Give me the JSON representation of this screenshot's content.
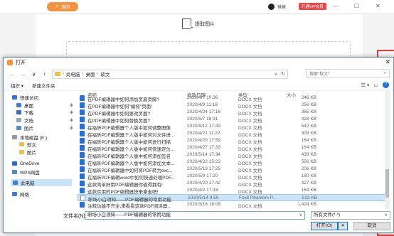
{
  "background_app": {
    "back_label": "返回",
    "user_name": "爸爸",
    "vip_label": "开通VIP会员",
    "window_controls": [
      "—",
      "☐",
      "✕"
    ],
    "extract_label": "提取图片"
  },
  "dialog": {
    "title": "打开",
    "nav": {
      "back": "←",
      "forward": "→",
      "dropdown": "∨",
      "up": "↑",
      "breadcrumb": [
        "此电脑",
        "桌面",
        "软文"
      ],
      "search_placeholder": "搜索\"软文\""
    },
    "toolbar": {
      "organize": "组织 ▾",
      "new_folder": "新建文件夹",
      "view_icon": "☰ ▾",
      "pane_icon": "▭"
    },
    "sidebar": [
      {
        "label": "快速访问",
        "icon": "star-icon",
        "color": "#2b78d4"
      },
      {
        "label": "桌面",
        "icon": "desktop-icon",
        "color": "#3a7fd9",
        "pinned": true
      },
      {
        "label": "下载",
        "icon": "download-icon",
        "color": "#2b6fd6",
        "pinned": true
      },
      {
        "label": "文档",
        "icon": "document-icon",
        "color": "#9aa5b4",
        "pinned": true
      },
      {
        "label": "图片",
        "icon": "picture-icon",
        "color": "#4e8fd6",
        "pinned": true
      },
      {
        "label": "本地磁盘 (E:)",
        "icon": "drive-icon",
        "color": "#8f98a4"
      },
      {
        "label": "软文",
        "icon": "folder-icon",
        "color": "#f1c04d"
      },
      {
        "label": "图片",
        "icon": "folder-icon",
        "color": "#f1c04d"
      },
      {
        "label": "OneDrive",
        "icon": "cloud-icon",
        "color": "#1f72c8"
      },
      {
        "label": "WPS网盘",
        "icon": "cloud-icon",
        "color": "#4a8bd4"
      },
      {
        "label": "此电脑",
        "icon": "computer-icon",
        "color": "#3a7fd9",
        "selected": true
      },
      {
        "label": "网络",
        "icon": "network-icon",
        "color": "#3a7fd9"
      }
    ],
    "columns": {
      "name": "名称",
      "date": "修改日期",
      "type": "类型",
      "size": "大小"
    },
    "files": [
      {
        "name": "在PDF编辑器中如何添加页眉页脚?",
        "date": "2020/4/7 10:36",
        "type": "DOCX 文档",
        "size": "246 KB",
        "icon": "word"
      },
      {
        "name": "在PDF编辑器中如何\"编排\"页面!",
        "date": "2020/4/9 11:18",
        "type": "DOCX 文档",
        "size": "256 KB",
        "icon": "word"
      },
      {
        "name": "在PDF编辑器中如何更改页面?",
        "date": "2020/4/24 17:16",
        "type": "DOCX 文档",
        "size": "385 KB",
        "icon": "word"
      },
      {
        "name": "在PDF编辑器中如何替换页面?",
        "date": "2020/5/7 18:31",
        "type": "DOCX 文档",
        "size": "428 KB",
        "icon": "word"
      },
      {
        "name": "在福昕PDF编辑器个人版中如何调整图像",
        "date": "2020/5/12 17:49",
        "type": "DOCX 文档",
        "size": "542 KB",
        "icon": "word"
      },
      {
        "name": "在福昕PDF编辑器个人版中如何对文件进...",
        "date": "2020/4/21 11:22",
        "type": "DOCX 文档",
        "size": "309 KB",
        "icon": "word"
      },
      {
        "name": "在福昕PDF编辑器个人版中如何进行扫描",
        "date": "2020/4/29 17:59",
        "type": "DOCX 文档",
        "size": "164 KB",
        "icon": "word"
      },
      {
        "name": "在福昕PDF编辑器个人版中如何快速定位...",
        "date": "2020/4/27 17:33",
        "type": "DOCX 文档",
        "size": "164 KB",
        "icon": "word"
      },
      {
        "name": "在福昕PDF编辑器个人版中如何添加签名",
        "date": "2020/5/14 17:34",
        "type": "DOCX 文档",
        "size": "439 KB",
        "icon": "word"
      },
      {
        "name": "在福昕PDF编辑器个人版中如何添加文本...",
        "date": "2020/4/22 15:22",
        "type": "DOCX 文档",
        "size": "556 KB",
        "icon": "word"
      },
      {
        "name": "在福昕PDF编辑器中如何将PDF转为exc...",
        "date": "2020/5/19 17:25",
        "type": "DOCX 文档",
        "size": "206 KB",
        "icon": "word"
      },
      {
        "name": "在福昕PDF编辑word中如何快速处理PDF...",
        "date": "2020/5/9 17:20",
        "type": "DOCX 文档",
        "size": "180 KB",
        "icon": "word"
      },
      {
        "name": "这款简单好用PDF编辑器你值得拥有!",
        "date": "2020/4/20 17:42",
        "type": "DOCX 文档",
        "size": "427 KB",
        "icon": "word"
      },
      {
        "name": "这款实用的PDF编辑器快来拿走吧!",
        "date": "2020/4/2 17:33",
        "type": "DOCX 文档",
        "size": "164 KB",
        "icon": "word"
      },
      {
        "name": "职场小白须知——PDF编辑器的常用功能",
        "date": "2020/5/14 9:59",
        "type": "Foxit Phantom P...",
        "size": "513 KB",
        "icon": "pdf",
        "selected": true
      },
      {
        "name": "注释功能不齐全,来看看这款PDF阅读器...",
        "date": "2020/3/16 18:08",
        "type": "DOCX 文档",
        "size": "1,424 KB",
        "icon": "word"
      }
    ],
    "filename_label": "文件名(N):",
    "filename_value": "职场小白须知——PDF编辑器的常用功能",
    "filetype_value": "所有文件(*.*)",
    "open_label": "打开(O)",
    "open_split": "▾",
    "cancel_label": "取消"
  }
}
